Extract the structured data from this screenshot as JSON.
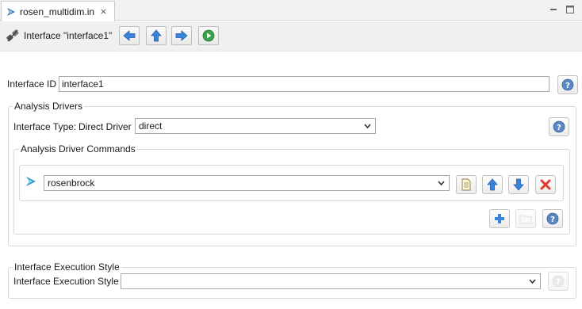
{
  "tab": {
    "title": "rosen_multidim.in",
    "close_glyph": "⨯"
  },
  "header": {
    "title": "Interface \"interface1\""
  },
  "interface_id": {
    "label": "Interface ID",
    "value": "interface1"
  },
  "analysis_drivers": {
    "group_title": "Analysis Drivers",
    "interface_type_label": "Interface Type:",
    "driver_label": "Direct Driver",
    "driver_value": "direct"
  },
  "driver_commands": {
    "group_title": "Analysis Driver Commands",
    "command_value": "rosenbrock"
  },
  "execution_style": {
    "group_title": "Interface Execution Style",
    "label": "Interface Execution Style",
    "value": ""
  },
  "colors": {
    "accent_blue": "#3b82d9",
    "run_green": "#3aa14a",
    "delete_red": "#e53b2c",
    "help_blue": "#5b86c5"
  }
}
